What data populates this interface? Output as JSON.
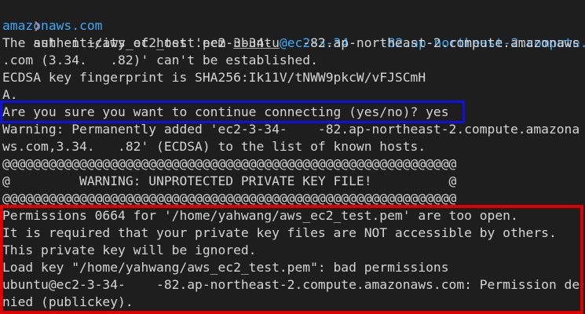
{
  "terminal": {
    "prompt": {
      "arrow": "❯",
      "command": "ssh -i ~/aws_ec2_test.pem ",
      "user": "ubuntu",
      "host_part1": "@ec2-3-34-",
      "host_part2": "-82.ap-northeast-2.compute.",
      "host_wrap": "amazonaws.com"
    },
    "lines": [
      "The authenticity of host 'ec2-3-34-    -82.ap-northeast-2.compute.amazonaws",
      ".com (3.34.   .82)' can't be established.",
      "ECDSA key fingerprint is SHA256:Ik11V/tNWW9pkcW/vFJSCmH",
      "A.",
      "Are you sure you want to continue connecting (yes/no)? yes",
      "Warning: Permanently added 'ec2-3-34-    -82.ap-northeast-2.compute.amazona",
      "ws.com,3.34.   .82' (ECDSA) to the list of known hosts.",
      "@@@@@@@@@@@@@@@@@@@@@@@@@@@@@@@@@@@@@@@@@@@@@@@@@@@@@@@@@@@",
      "@         WARNING: UNPROTECTED PRIVATE KEY FILE!          @",
      "@@@@@@@@@@@@@@@@@@@@@@@@@@@@@@@@@@@@@@@@@@@@@@@@@@@@@@@@@@@",
      "Permissions 0664 for '/home/yahwang/aws_ec2_test.pem' are too open.",
      "It is required that your private key files are NOT accessible by others.",
      "This private key will be ignored.",
      "Load key \"/home/yahwang/aws_ec2_test.pem\": bad permissions",
      "ubuntu@ec2-3-34-    -82.ap-northeast-2.compute.amazonaws.com: Permission de",
      "nied (publickey)."
    ]
  },
  "colors": {
    "background": "#1e1e1e",
    "text": "#d4d4d4",
    "prompt_arrow": "#e06c75",
    "host": "#3fa9f5",
    "highlight_blue": "#1010e0",
    "highlight_red": "#e00000"
  }
}
